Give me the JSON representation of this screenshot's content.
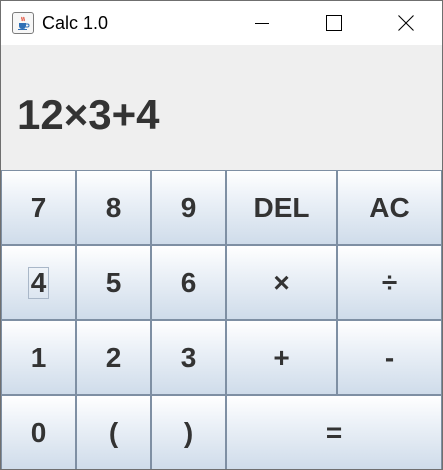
{
  "window": {
    "title": "Calc 1.0",
    "icon": "java-cup-icon",
    "controls": {
      "minimize_icon": "minimize-icon",
      "maximize_icon": "maximize-icon",
      "close_icon": "close-icon"
    }
  },
  "display": {
    "expression": "12×3+4"
  },
  "keypad": {
    "focused_key": "4",
    "keys": [
      {
        "label": "7"
      },
      {
        "label": "8"
      },
      {
        "label": "9"
      },
      {
        "label": "DEL"
      },
      {
        "label": "AC"
      },
      {
        "label": "4"
      },
      {
        "label": "5"
      },
      {
        "label": "6"
      },
      {
        "label": "×"
      },
      {
        "label": "÷"
      },
      {
        "label": "1"
      },
      {
        "label": "2"
      },
      {
        "label": "3"
      },
      {
        "label": "+"
      },
      {
        "label": "-"
      },
      {
        "label": "0"
      },
      {
        "label": "("
      },
      {
        "label": ")"
      },
      {
        "label": "="
      }
    ]
  },
  "colors": {
    "display_background": "#efefef",
    "display_text": "#333333",
    "key_border": "#7e8fa3",
    "key_gradient_top": "#ffffff",
    "key_gradient_bottom": "#cfdcea"
  }
}
